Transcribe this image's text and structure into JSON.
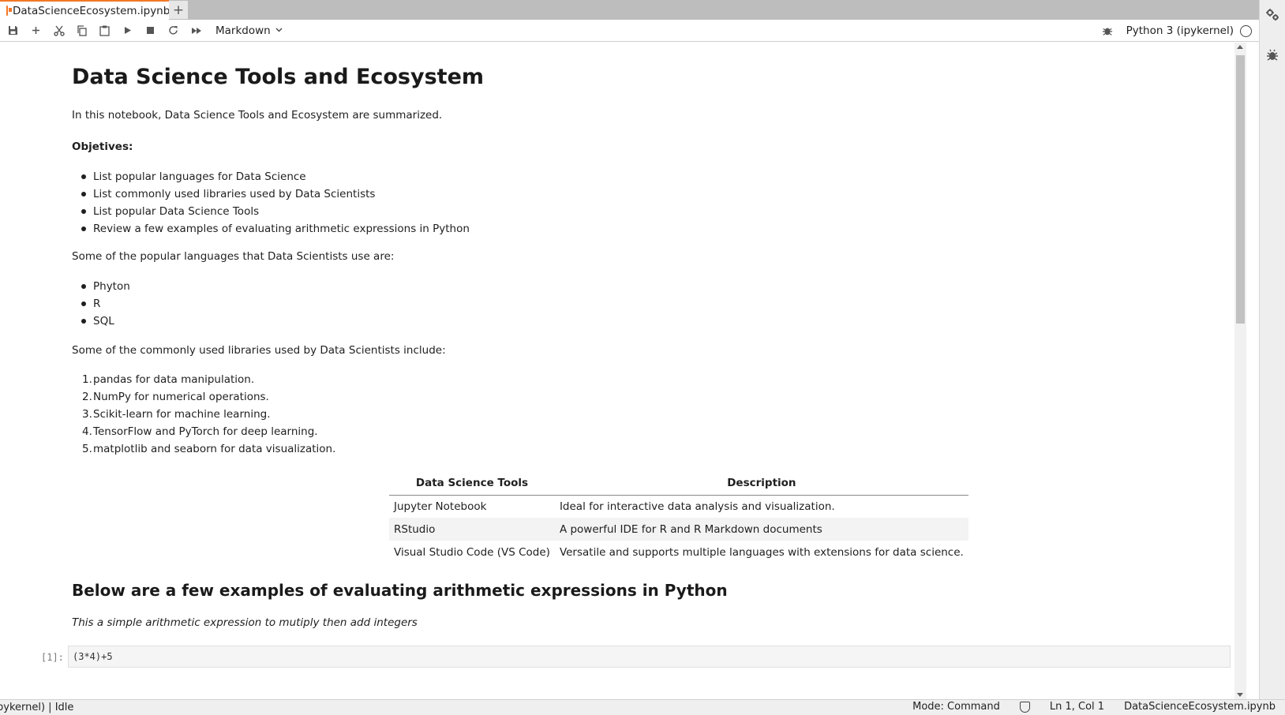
{
  "tab": {
    "title": "DataScienceEcosystem.ipynb",
    "close_glyph": "×",
    "add_glyph": "+"
  },
  "toolbar": {
    "buttons": [
      {
        "name": "save-button",
        "icon": "save-icon"
      },
      {
        "name": "insert-cell-button",
        "icon": "plus-icon"
      },
      {
        "name": "cut-button",
        "icon": "scissors-icon"
      },
      {
        "name": "copy-button",
        "icon": "copy-icon"
      },
      {
        "name": "paste-button",
        "icon": "paste-icon"
      },
      {
        "name": "run-button",
        "icon": "play-icon"
      },
      {
        "name": "interrupt-button",
        "icon": "stop-icon"
      },
      {
        "name": "restart-button",
        "icon": "restart-icon"
      },
      {
        "name": "run-all-button",
        "icon": "fast-forward-icon"
      }
    ],
    "cell_type": "Markdown",
    "kernel_name": "Python 3 (ipykernel)"
  },
  "notebook": {
    "title": "Data Science Tools and Ecosystem",
    "intro": "In this notebook, Data Science Tools and Ecosystem are summarized.",
    "objectives_heading": "Objetives:",
    "objectives": [
      "List popular languages for Data Science",
      "List commonly used libraries used by Data Scientists",
      "List popular Data Science Tools",
      "Review a few examples of evaluating arithmetic expressions in Python"
    ],
    "languages_intro": "Some of the popular languages that Data Scientists use are:",
    "languages": [
      "Phyton",
      "R",
      "SQL"
    ],
    "libraries_intro": "Some of the commonly used libraries used by Data Scientists include:",
    "libraries": [
      "pandas for data manipulation.",
      "NumPy for numerical operations.",
      "Scikit-learn for machine learning.",
      "TensorFlow and PyTorch for deep learning.",
      "matplotlib and seaborn for data visualization."
    ],
    "table": {
      "headers": [
        "Data Science Tools",
        "Description"
      ],
      "rows": [
        [
          "Jupyter Notebook",
          "Ideal for interactive data analysis and visualization."
        ],
        [
          "RStudio",
          "A powerful IDE for R and R Markdown documents"
        ],
        [
          "Visual Studio Code (VS Code)",
          "Versatile and supports multiple languages with extensions for data science."
        ]
      ]
    },
    "examples_heading": "Below are a few examples of evaluating arithmetic expressions in Python",
    "example_note": "This a simple arithmetic expression to mutiply then add integers",
    "code_prompt": "[1]:",
    "code": "(3*4)+5"
  },
  "statusbar": {
    "left": "pykernel) | Idle",
    "mode": "Mode: Command",
    "position": "Ln 1, Col 1",
    "filename": "DataScienceEcosystem.ipynb"
  }
}
